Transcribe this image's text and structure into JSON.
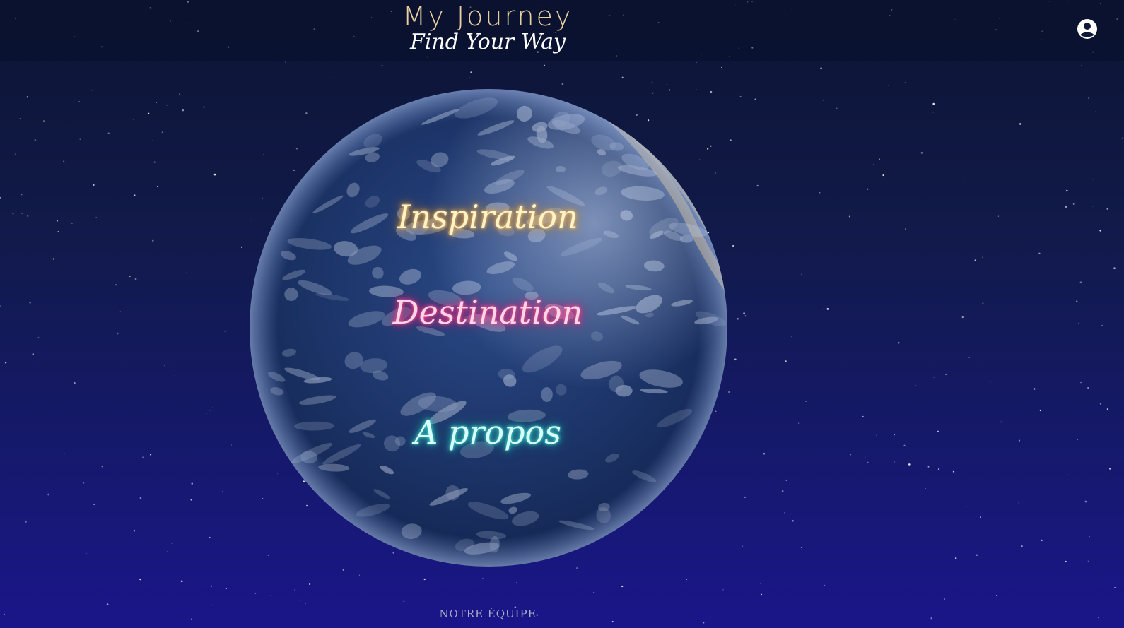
{
  "header": {
    "title": "My Journey",
    "subtitle": "Find Your Way",
    "account_icon": "account-circle-icon"
  },
  "menu": {
    "inspiration": "Inspiration",
    "destination": "Destination",
    "apropos": "A propos"
  },
  "footer": {
    "team_link": "NOTRE ÉQUIPE"
  },
  "colors": {
    "title": "#e8cfa0",
    "inspiration_glow": "#e6a33c",
    "destination_glow": "#ff2f83",
    "apropos_glow": "#29cbbf",
    "background_top": "#0c1434",
    "background_bottom": "#1a168a"
  }
}
